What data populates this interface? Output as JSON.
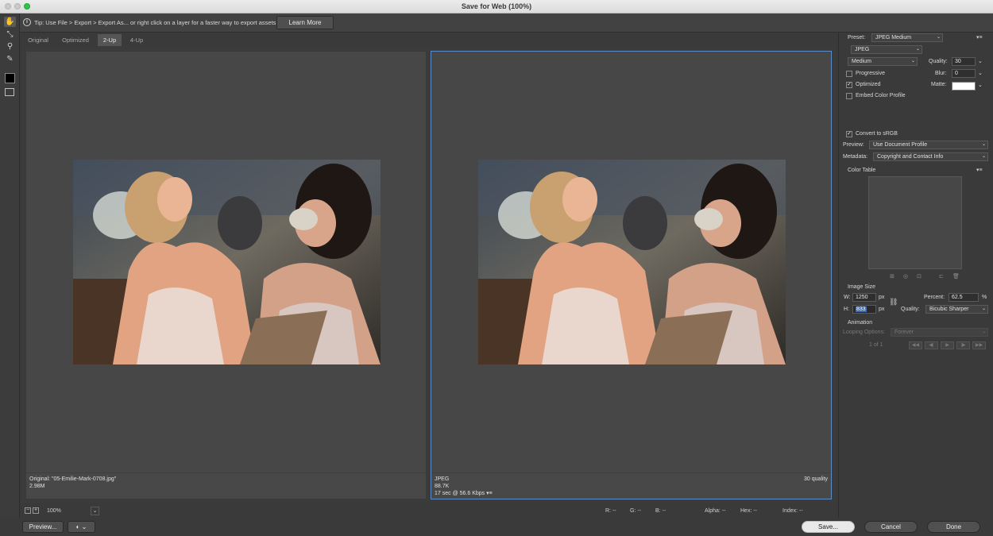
{
  "window": {
    "title": "Save for Web (100%)"
  },
  "tip": {
    "text": "Tip: Use File > Export > Export As...  or right click on a layer for a faster way to export assets",
    "button": "Learn More"
  },
  "tabs": [
    "Original",
    "Optimized",
    "2-Up",
    "4-Up"
  ],
  "active_tab": "2-Up",
  "left_pane": {
    "line1": "Original: \"05-Emilie-Mark-0708.jpg\"",
    "line2": "2.98M"
  },
  "right_pane": {
    "line1": "JPEG",
    "line2": "88.7K",
    "line3": "17 sec @ 56.6 Kbps",
    "quality_label": "30 quality"
  },
  "zoom": {
    "value": "100%"
  },
  "status": {
    "r": "R: --",
    "g": "G: --",
    "b": "B: --",
    "alpha": "Alpha: --",
    "hex": "Hex: --",
    "index": "Index: --"
  },
  "buttons": {
    "preview": "Preview...",
    "save": "Save...",
    "cancel": "Cancel",
    "done": "Done"
  },
  "settings": {
    "preset_label": "Preset:",
    "preset_value": "JPEG Medium",
    "format": "JPEG",
    "quality_level": "Medium",
    "quality_label": "Quality:",
    "quality_value": "30",
    "progressive": "Progressive",
    "blur_label": "Blur:",
    "blur_value": "0",
    "optimized": "Optimized",
    "matte_label": "Matte:",
    "embed": "Embed Color Profile",
    "convert": "Convert to sRGB",
    "preview_label": "Preview:",
    "preview_value": "Use Document Profile",
    "metadata_label": "Metadata:",
    "metadata_value": "Copyright and Contact Info",
    "color_table": "Color Table",
    "image_size": "Image Size",
    "w_label": "W:",
    "w_value": "1250",
    "h_label": "H:",
    "h_value": "833",
    "px1": "px",
    "px2": "px",
    "percent_label": "Percent:",
    "percent_value": "62.5",
    "percent_unit": "%",
    "resample_label": "Quality:",
    "resample_value": "Bicubic Sharper",
    "animation": "Animation",
    "looping_label": "Looping Options:",
    "looping_value": "Forever",
    "frame_count": "1 of 1"
  }
}
